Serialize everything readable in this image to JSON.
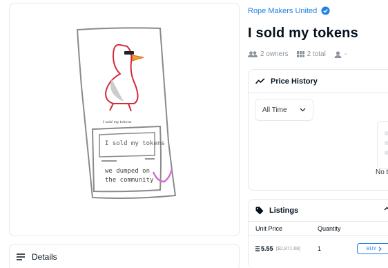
{
  "collection": {
    "name": "Rope Makers United"
  },
  "item": {
    "title": "I sold my tokens"
  },
  "stats": {
    "owners": "2 owners",
    "total": "2 total",
    "owner_name": "-"
  },
  "artwork": {
    "caption": "I sold my tokens",
    "box_line1": "I sold my tokens",
    "box_line2": "we dumped on",
    "box_line3": "the community"
  },
  "price_history": {
    "title": "Price History",
    "range": "All Time",
    "empty_text": "No t"
  },
  "listings": {
    "title": "Listings",
    "columns": [
      "Unit Price",
      "Quantity"
    ],
    "rows": [
      {
        "price": "5.55",
        "usd": "($2,871.68)",
        "quantity": "1",
        "action": "BUY"
      }
    ]
  },
  "details": {
    "title": "Details"
  },
  "colors": {
    "accent": "#2081e2",
    "text": "#04111d",
    "muted": "#8a939b",
    "border": "#e5e8eb"
  },
  "icons": [
    "verified-badge-icon",
    "owners-icon",
    "grid-icon",
    "person-icon",
    "trend-icon",
    "chevron-down-icon",
    "tag-icon",
    "chevron-up-icon",
    "eth-icon",
    "menu-lines-icon"
  ]
}
